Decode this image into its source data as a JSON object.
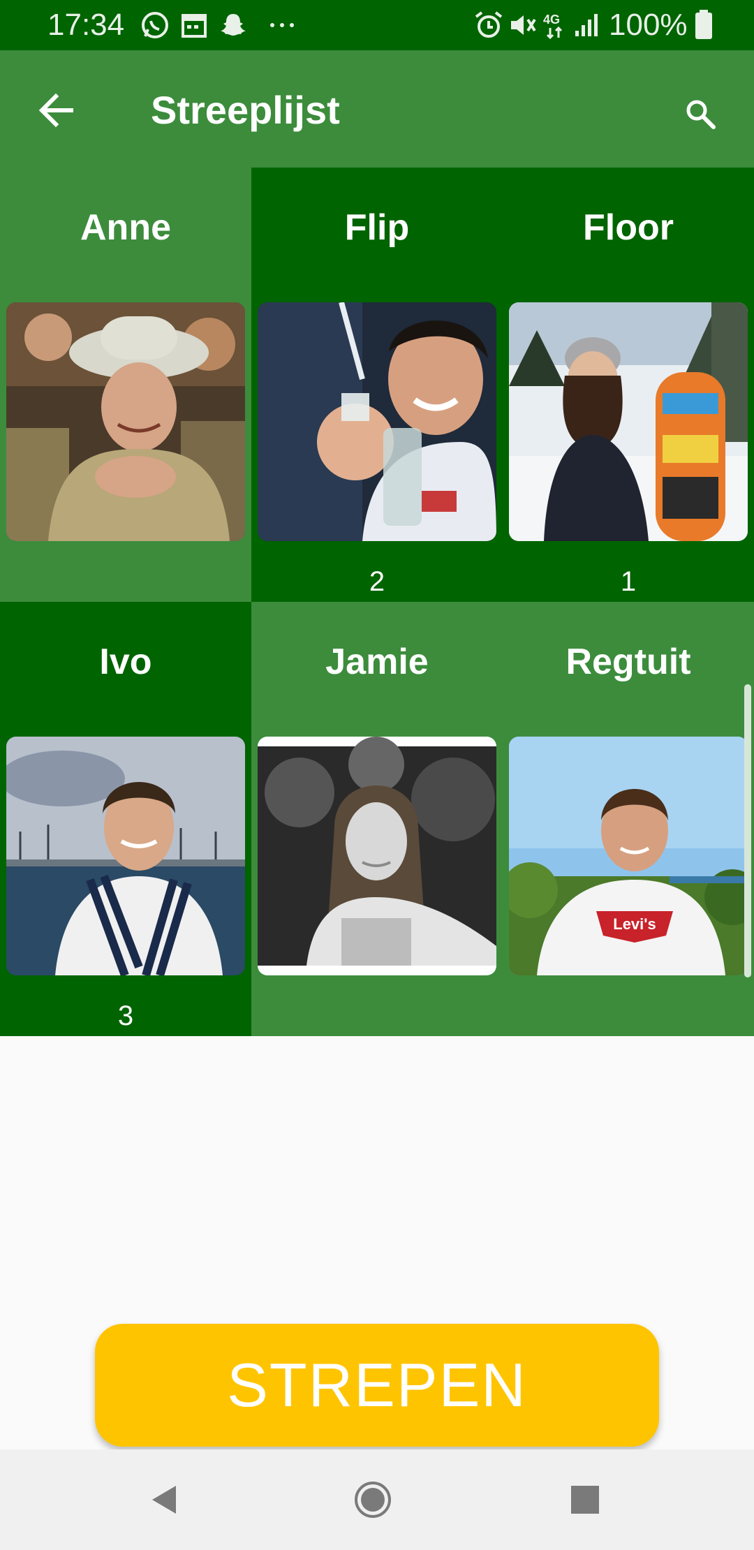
{
  "status_bar": {
    "time": "17:34",
    "battery": "100%",
    "network": "4G",
    "icons": [
      "whatsapp-icon",
      "calendar-icon",
      "snapchat-icon",
      "more-notifications-icon",
      "alarm-icon",
      "mute-icon",
      "signal-icon",
      "battery-icon"
    ]
  },
  "app_bar": {
    "title": "Streeplijst",
    "back_icon": "arrow-back-icon",
    "search_icon": "search-icon"
  },
  "people": [
    {
      "name": "Anne",
      "count": ""
    },
    {
      "name": "Flip",
      "count": "2"
    },
    {
      "name": "Floor",
      "count": "1"
    },
    {
      "name": "Ivo",
      "count": "3"
    },
    {
      "name": "Jamie",
      "count": ""
    },
    {
      "name": "Regtuit",
      "count": ""
    }
  ],
  "actions": {
    "strepen_label": "STREPEN"
  },
  "colors": {
    "status_bar": "#006400",
    "primary": "#3c8c3c",
    "tile_dark": "#006400",
    "accent": "#ffc400"
  },
  "nav_bar": {
    "icons": [
      "back-nav-icon",
      "home-nav-icon",
      "recents-nav-icon"
    ]
  }
}
